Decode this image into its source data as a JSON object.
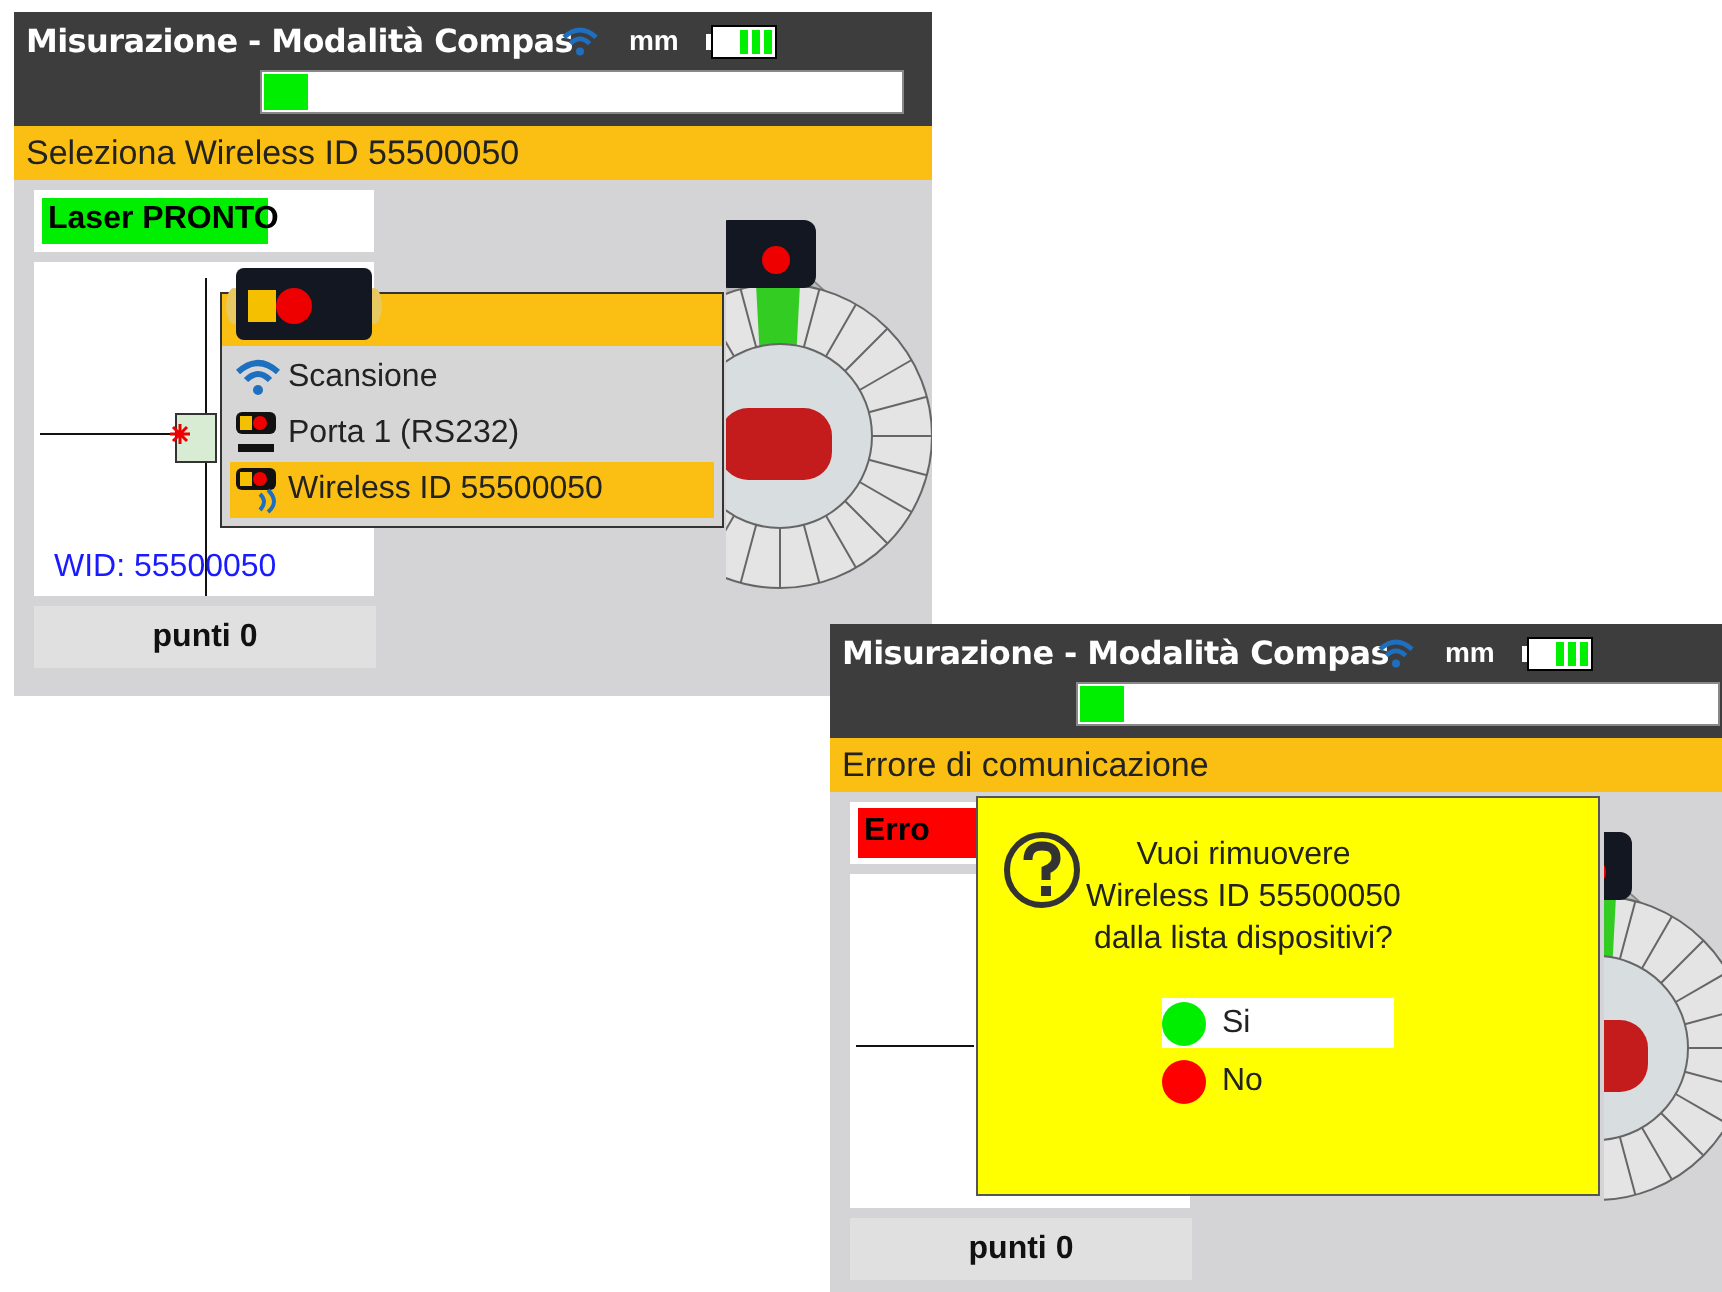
{
  "screens": [
    {
      "title": "Misurazione - Modalità Compas",
      "unit": "mm",
      "progress": {
        "level": 0.07
      },
      "status_bar": "Seleziona Wireless ID 55500050",
      "laser_status": {
        "text": "Laser PRONTO",
        "kind": "ready",
        "level": 0.7
      },
      "wid": "WID: 55500050",
      "points_button": "punti 0",
      "overlay": {
        "kind": "menu",
        "items": [
          {
            "label": "Scansione",
            "kind": "scan",
            "selected": false
          },
          {
            "label": "Porta 1 (RS232)",
            "kind": "cable",
            "selected": false
          },
          {
            "label": "Wireless ID 55500050",
            "kind": "wireless",
            "selected": true
          }
        ]
      }
    },
    {
      "title": "Misurazione - Modalità Compas",
      "unit": "mm",
      "progress": {
        "level": 0.07
      },
      "status_bar": "Errore di comunicazione",
      "laser_status": {
        "text": "Erro",
        "kind": "error"
      },
      "points_button": "punti 0",
      "overlay": {
        "kind": "dialog",
        "lines": [
          "Vuoi rimuovere",
          "Wireless ID 55500050",
          "dalla lista dispositivi?"
        ],
        "options": [
          {
            "label": "Si",
            "color": "#00ee00",
            "selected": true
          },
          {
            "label": "No",
            "color": "#ff0000",
            "selected": false
          }
        ]
      }
    }
  ]
}
